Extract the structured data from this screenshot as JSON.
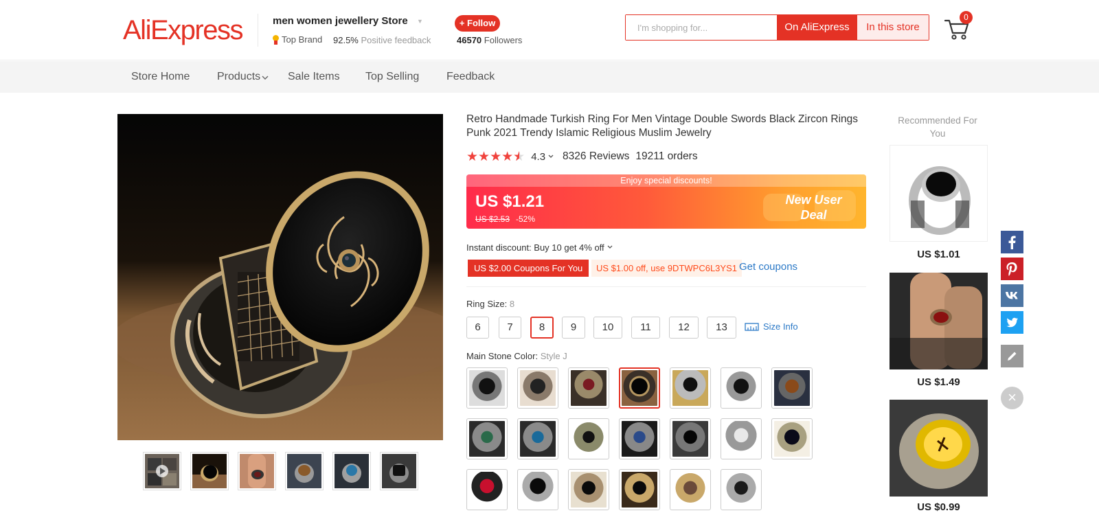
{
  "header": {
    "logo": "AliExpress",
    "store_name": "men women jewellery Store",
    "top_brand": "Top Brand",
    "feedback_pct": "92.5%",
    "feedback_label": "Positive feedback",
    "follow_label": "+ Follow",
    "followers_count": "46570",
    "followers_label": "Followers",
    "search_placeholder": "I'm shopping for...",
    "search_on_ali": "On AliExpress",
    "search_in_store": "In this store",
    "cart_count": "0"
  },
  "nav": {
    "items": [
      "Store Home",
      "Products",
      "Sale Items",
      "Top Selling",
      "Feedback"
    ]
  },
  "product": {
    "title": "Retro Handmade Turkish Ring For Men Vintage Double Swords Black Zircon Rings Punk 2021 Trendy Islamic Religious Muslim Jewelry",
    "rating": "4.3",
    "stars": 4.5,
    "reviews": "8326 Reviews",
    "orders": "19211 orders",
    "banner_top": "Enjoy special discounts!",
    "price": "US $1.21",
    "old_price": "US $2.53",
    "discount": "-52%",
    "deal_line1": "New User",
    "deal_line2": "Deal",
    "instant_discount": "Instant discount: Buy 10 get 4% off",
    "coupon_red": "US $2.00 Coupons For You",
    "coupon_code": "US $1.00 off, use 9DTWPC6L3YS1",
    "get_coupons": "Get coupons",
    "size_label": "Ring Size:",
    "size_selected": "8",
    "sizes": [
      "6",
      "7",
      "8",
      "9",
      "10",
      "11",
      "12",
      "13"
    ],
    "size_info": "Size Info",
    "color_label": "Main Stone Color:",
    "color_selected": "Style J"
  },
  "recommended": {
    "title": "Recommended For You",
    "items": [
      {
        "price": "US $1.01"
      },
      {
        "price": "US $1.49"
      },
      {
        "price": "US $0.99"
      }
    ]
  },
  "colors": {
    "accent": "#e43225",
    "link": "#2b79c7",
    "star": "#f0423c"
  }
}
